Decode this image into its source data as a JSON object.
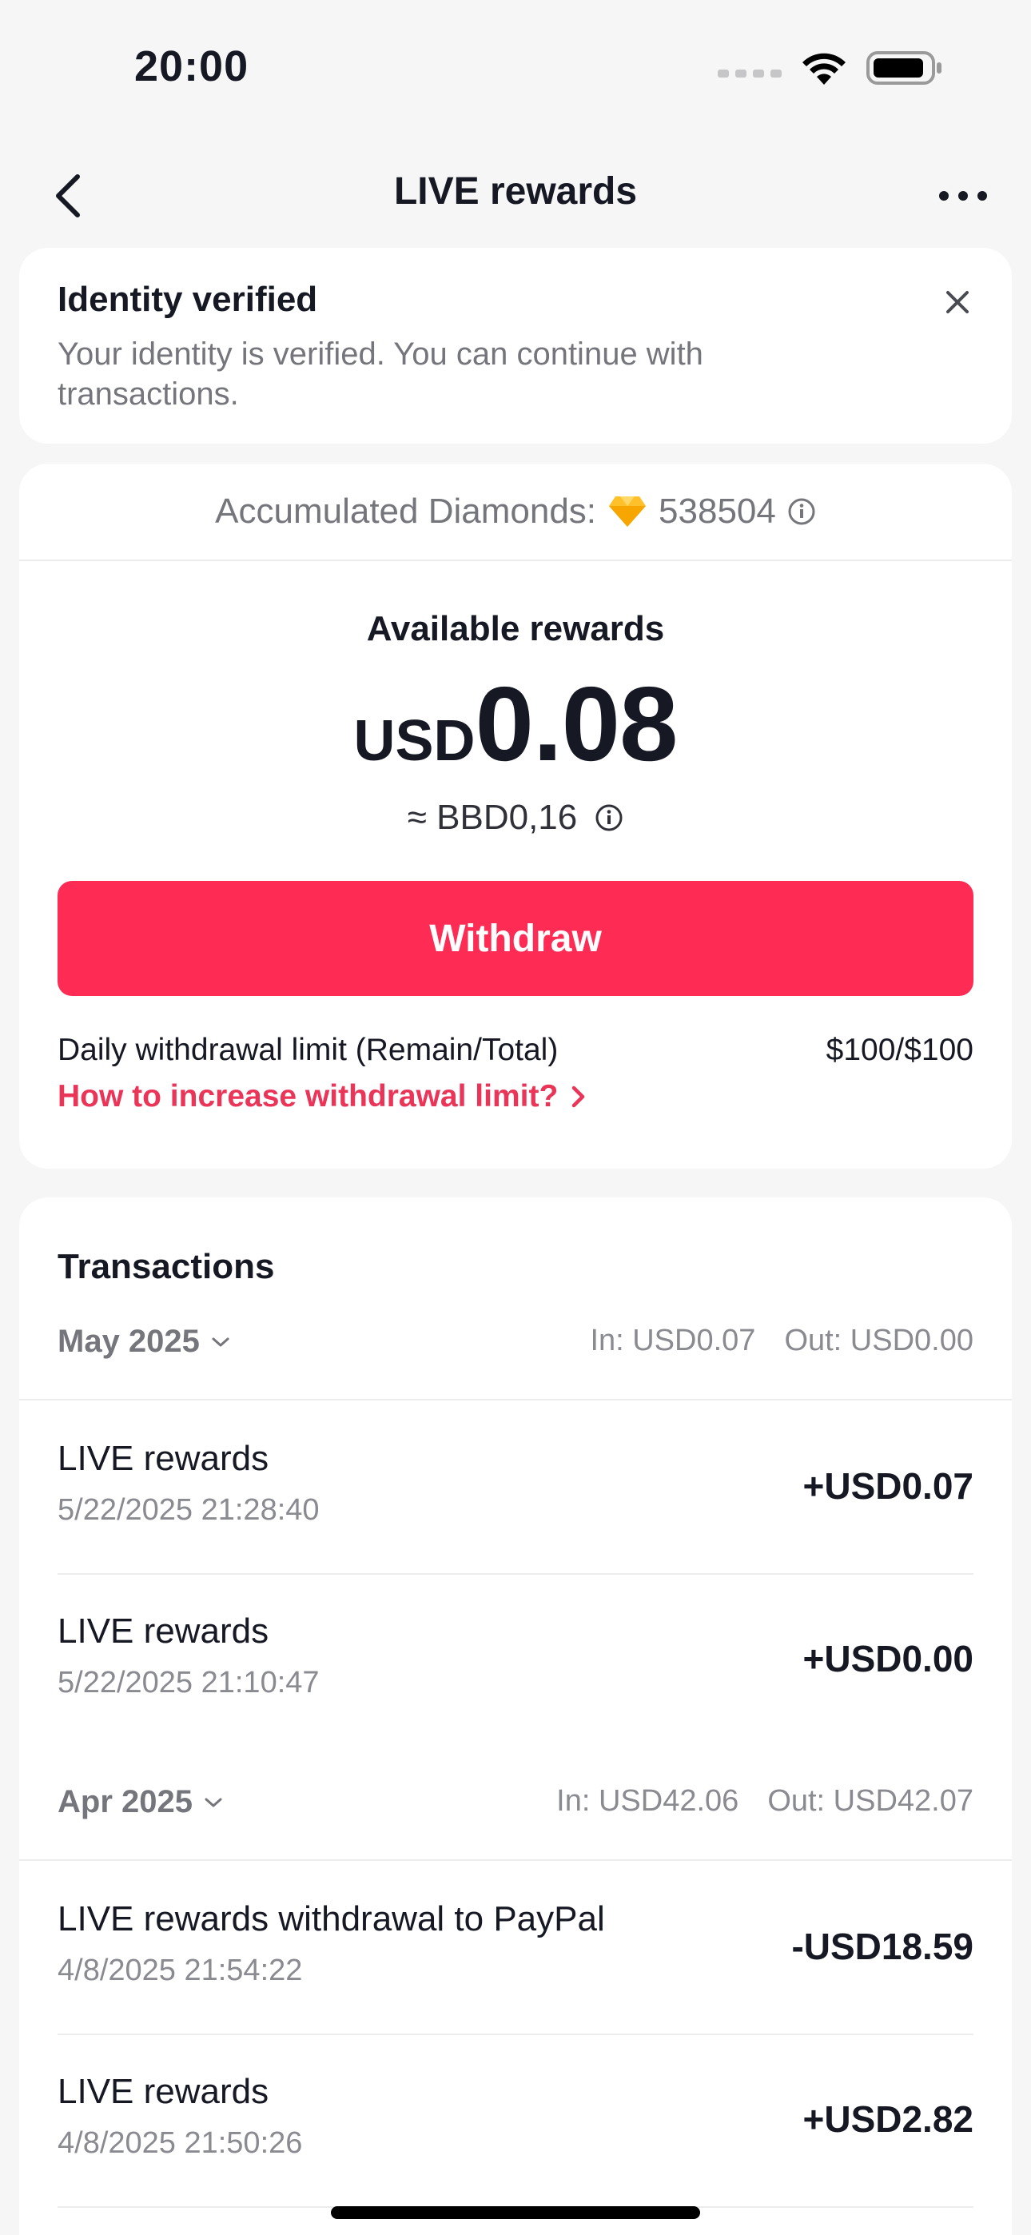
{
  "status_bar": {
    "time": "20:00",
    "battery_icon": "battery-icon",
    "wifi_icon": "wifi-icon"
  },
  "nav": {
    "title": "LIVE rewards",
    "back_icon": "back-chevron-icon",
    "more_icon": "more-dots-icon"
  },
  "identity": {
    "title": "Identity verified",
    "message": "Your identity is verified. You can continue with transactions."
  },
  "rewards": {
    "diamonds_label": "Accumulated Diamonds:",
    "diamonds_value": "538504",
    "available_label": "Available rewards",
    "currency": "USD",
    "amount": "0.08",
    "approx": "≈ BBD0,16",
    "withdraw_label": "Withdraw",
    "limit_label": "Daily withdrawal limit (Remain/Total)",
    "limit_value": "$100/$100",
    "limit_link": "How to increase withdrawal limit?"
  },
  "transactions": {
    "title": "Transactions",
    "months": [
      {
        "label": "May 2025",
        "in": "In: USD0.07",
        "out": "Out: USD0.00",
        "items": [
          {
            "name": "LIVE rewards",
            "date": "5/22/2025 21:28:40",
            "amount": "+USD0.07"
          },
          {
            "name": "LIVE rewards",
            "date": "5/22/2025 21:10:47",
            "amount": "+USD0.00"
          }
        ]
      },
      {
        "label": "Apr 2025",
        "in": "In: USD42.06",
        "out": "Out: USD42.07",
        "items": [
          {
            "name": "LIVE rewards withdrawal to PayPal",
            "date": "4/8/2025 21:54:22",
            "amount": "-USD18.59"
          },
          {
            "name": "LIVE rewards",
            "date": "4/8/2025 21:50:26",
            "amount": "+USD2.82"
          }
        ]
      }
    ]
  },
  "colors": {
    "accent": "#fe2c55",
    "link": "#ea3559",
    "muted": "#75767c"
  }
}
